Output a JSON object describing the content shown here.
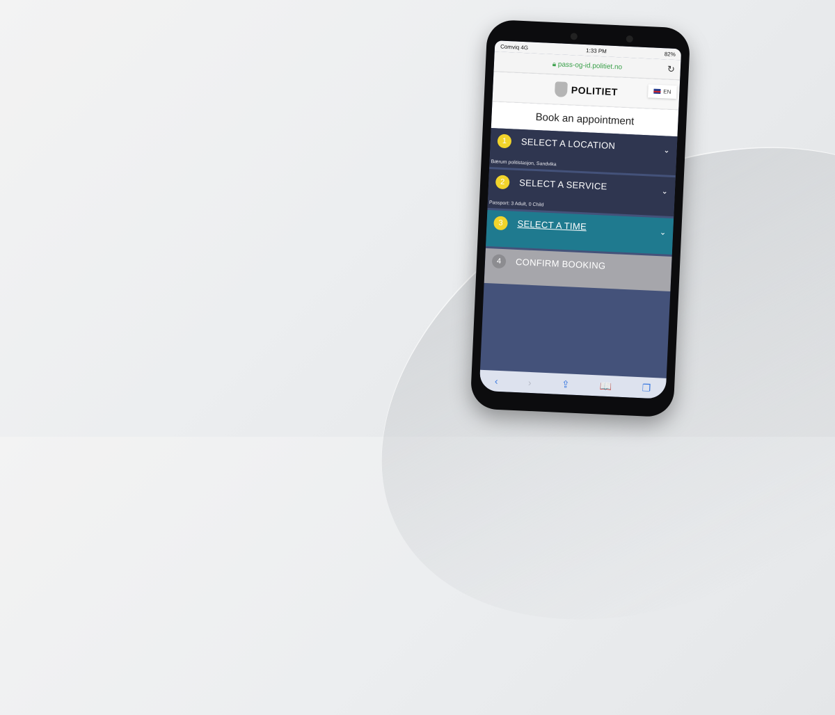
{
  "status_bar": {
    "carrier": "Comviq",
    "network": "4G",
    "time": "1:33 PM",
    "battery": "82%"
  },
  "browser": {
    "url": "pass-og-id.politiet.no",
    "reload_icon": "reload-icon",
    "lock_icon": "lock-icon"
  },
  "header": {
    "brand": "POLITIET",
    "language": "EN"
  },
  "page": {
    "title": "Book an appointment"
  },
  "steps": [
    {
      "number": "1",
      "label": "SELECT A LOCATION",
      "summary": "Bærum politistasjon, Sandvika",
      "state": "completed"
    },
    {
      "number": "2",
      "label": "SELECT A SERVICE",
      "summary": "Passport: 3 Adult, 0 Child",
      "state": "completed"
    },
    {
      "number": "3",
      "label": "SELECT A TIME",
      "summary": "",
      "state": "active"
    },
    {
      "number": "4",
      "label": "CONFIRM BOOKING",
      "summary": "",
      "state": "disabled"
    }
  ],
  "toolbar": {
    "back": "‹",
    "forward": "›",
    "share": "⇪",
    "bookmarks": "📖",
    "tabs": "❐"
  },
  "colors": {
    "step_dark": "#2f3650",
    "step_active": "#1f7a8f",
    "step_disabled": "#a6a6ab",
    "badge": "#f2d42b",
    "url_green": "#3aa04a"
  }
}
